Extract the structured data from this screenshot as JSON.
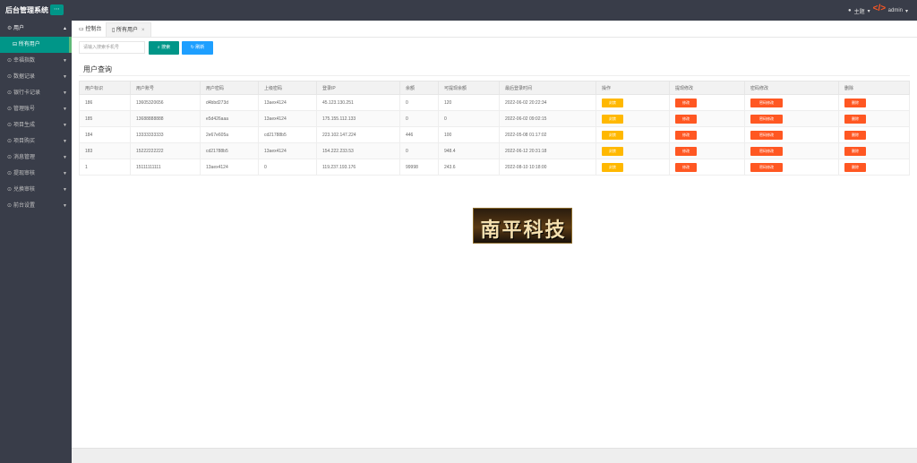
{
  "header": {
    "brand": "后台管理系统",
    "toggle": "⋯",
    "theme": "主题",
    "user": "admin"
  },
  "sidebar": {
    "items": [
      {
        "label": "用户",
        "open": true
      },
      {
        "label": "所有用户",
        "sub": true
      },
      {
        "label": "幸福指数"
      },
      {
        "label": "数据记录"
      },
      {
        "label": "银行卡记录"
      },
      {
        "label": "管理账号"
      },
      {
        "label": "项目生成"
      },
      {
        "label": "项目购买"
      },
      {
        "label": "消息管理"
      },
      {
        "label": "提现审核"
      },
      {
        "label": "兑换审核"
      },
      {
        "label": "前台设置"
      }
    ]
  },
  "tabs": [
    {
      "label": "控制台"
    },
    {
      "label": "所有用户",
      "close": "×"
    }
  ],
  "toolbar": {
    "search_placeholder": "请输入搜索手机号",
    "search_label": "搜索",
    "refresh_label": "刷新"
  },
  "panel": {
    "title": "用户查询"
  },
  "table": {
    "headers": [
      "用户标识",
      "用户账号",
      "用户密码",
      "上级密码",
      "登录IP",
      "余额",
      "可提现余额",
      "最后登录时间",
      "操作",
      "提现修改",
      "密码修改",
      "删除"
    ],
    "action_labels": {
      "op": "封禁",
      "edit": "修改",
      "pwd": "密码修改",
      "del": "删除"
    },
    "rows": [
      [
        "186",
        "13605320656",
        "d4bbd273d",
        "13aex4124",
        "45.123.130.251",
        "0",
        "120",
        "2022-06-02 20:22:34"
      ],
      [
        "185",
        "13688888888",
        "e5d426aaa",
        "13aex4124",
        "175.155.112.133",
        "0",
        "0",
        "2022-06-02 09:02:15"
      ],
      [
        "184",
        "13333333333",
        "2e67e605a",
        "cd21788b5",
        "223.102.147.224",
        "446",
        "100",
        "2022-05-08 01:17:02"
      ],
      [
        "183",
        "15222222222",
        "cd21788b5",
        "13aex4124",
        "154.222.233.53",
        "0",
        "948.4",
        "2022-06-12 20:31:18"
      ],
      [
        "1",
        "15111111111",
        "13aex4124",
        "0",
        "119.237.193.176",
        "99998",
        "243.6",
        "2022-08-10 10:18:00"
      ]
    ]
  },
  "watermark": {
    "text": "南平科技"
  }
}
